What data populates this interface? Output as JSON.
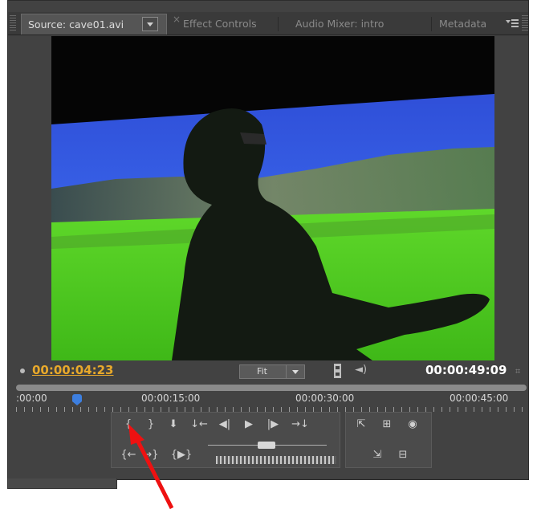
{
  "tabs": {
    "source": "Source: cave01.avi",
    "close": "×",
    "effect_controls": "Effect Controls",
    "audio_mixer": "Audio Mixer: intro",
    "metadata": "Metadata"
  },
  "monitor": {
    "current_time": "00:00:04:23",
    "zoom_select": "Fit",
    "duration": "00:00:49:09",
    "settings_glyph": "⌗"
  },
  "ruler": {
    "labels": [
      ":00:00",
      "00:00:15:00",
      "00:00:30:00",
      "00:00:45:00"
    ]
  },
  "controls": {
    "mark_in": "{",
    "mark_out": "}",
    "add_marker": "⬇",
    "goto_in": "↓←",
    "step_back": "◀|",
    "play": "▶",
    "step_forward": "|▶",
    "goto_out": "→↓",
    "insert": "⇱",
    "safe_margins": "⊞",
    "output": "◉",
    "clear_in": "{←",
    "clear_out": "→}",
    "play_in_to_out": "{▶}",
    "overlay": "⇲",
    "export_frame": "⊟"
  },
  "colors": {
    "timecode_current": "#e8a92b",
    "panel_bg": "#424242",
    "arrow": "#ee1111",
    "playhead": "#3d7fe0"
  }
}
